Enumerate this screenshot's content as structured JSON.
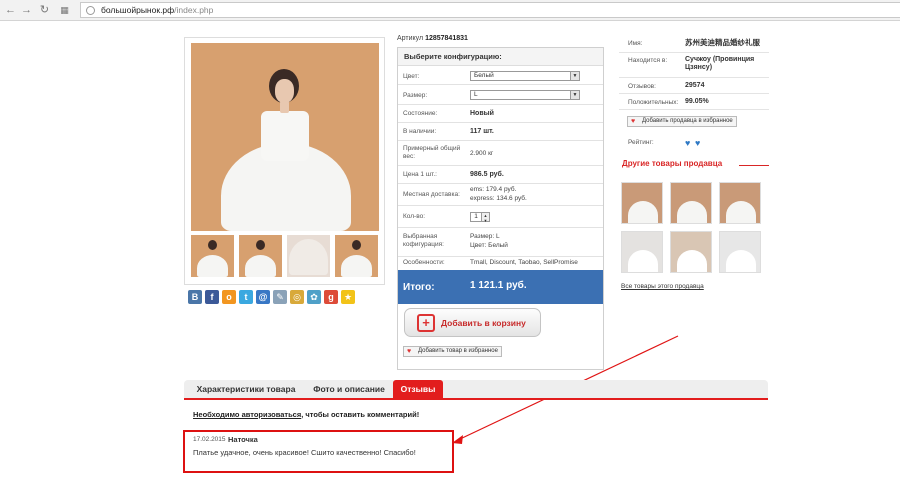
{
  "browser": {
    "url_host": "большойрынок.рф",
    "url_path": "/index.php"
  },
  "product": {
    "artikul_label": "Артикул",
    "artikul": "12857841831"
  },
  "config": {
    "header": "Выберите конфигурацию:",
    "color_label": "Цвет:",
    "color_value": "Белый",
    "size_label": "Размер:",
    "size_value": "L",
    "condition_label": "Состояние:",
    "condition_value": "Новый",
    "stock_label": "В наличии:",
    "stock_value": "117 шт.",
    "weight_label": "Примерный общий вес:",
    "weight_value": "2.900 кг",
    "price_label": "Цена 1 шт.:",
    "price_value": "986.5 руб.",
    "delivery_label": "Местная доставка:",
    "delivery_ems": "ems: 179.4 руб.",
    "delivery_express": "express: 134.6 руб.",
    "qty_label": "Кол-во:",
    "qty_value": "1",
    "selected_label": "Выбранная кофигурация:",
    "selected_size": "Размер: L",
    "selected_color": "Цвет: Белый",
    "features_label": "Особенности:",
    "features_value": "Tmall, Discount, Taobao, SellPromise",
    "total_label": "Итого:",
    "total_value": "1 121.1 руб.",
    "cart_button": "Добавить в корзину",
    "fav_product": "Добавить товар в избранное"
  },
  "seller": {
    "name_label": "Имя:",
    "name_value": "苏州美迪精品婚纱礼服",
    "location_label": "Находится в:",
    "location_value": "Сучжоу (Провинция Цзянсу)",
    "reviews_label": "Отзывов:",
    "reviews_value": "29574",
    "positive_label": "Положительных:",
    "positive_value": "99.05%",
    "fav_seller": "Добавить продавца в избранное",
    "rating_label": "Рейтинг:",
    "other_title": "Другие товары продавца",
    "all_link": "Все товары этого продавца"
  },
  "tabs": [
    {
      "label": "Характеристики товара"
    },
    {
      "label": "Фото и описание"
    },
    {
      "label": "Отзывы"
    }
  ],
  "reviews": {
    "login_link": "Необходимо авторизоваться",
    "login_rest": ", чтобы оставить комментарий!",
    "date": "17.02.2015",
    "author": "Наточка",
    "text": "Платье удачное, очень красивое! Сшито качественно! Спасибо!"
  },
  "share_icons": [
    {
      "name": "vk",
      "glyph": "В",
      "color": "#4a76a8"
    },
    {
      "name": "facebook",
      "glyph": "f",
      "color": "#3b5998"
    },
    {
      "name": "odnoklassniki",
      "glyph": "о",
      "color": "#f29620"
    },
    {
      "name": "twitter",
      "glyph": "t",
      "color": "#3aa8e0"
    },
    {
      "name": "mailru",
      "glyph": "@",
      "color": "#3877c5"
    },
    {
      "name": "livejournal",
      "glyph": "✎",
      "color": "#8aa2b8"
    },
    {
      "name": "moimir",
      "glyph": "◎",
      "color": "#d8a93a"
    },
    {
      "name": "liveinternet",
      "glyph": "✿",
      "color": "#4fa0c8"
    },
    {
      "name": "google",
      "glyph": "g",
      "color": "#dd4b39"
    },
    {
      "name": "bookmark",
      "glyph": "★",
      "color": "#f2c318"
    }
  ]
}
